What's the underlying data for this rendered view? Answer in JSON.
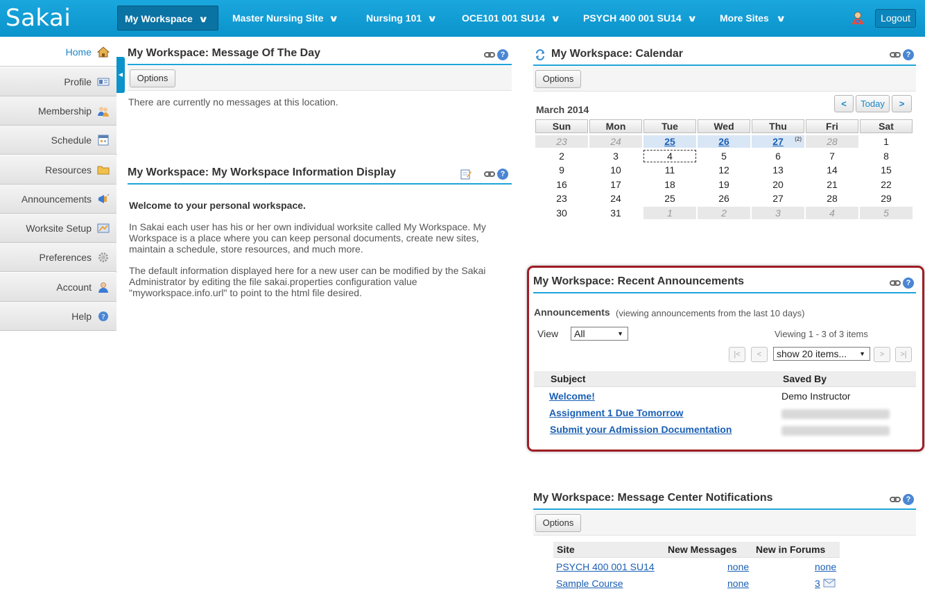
{
  "header": {
    "logo": "Sakai",
    "sites": [
      {
        "label": "My Workspace"
      },
      {
        "label": "Master Nursing Site"
      },
      {
        "label": "Nursing 101"
      },
      {
        "label": "OCE101 001 SU14"
      },
      {
        "label": "PSYCH 400 001 SU14"
      },
      {
        "label": "More Sites"
      }
    ],
    "logout": "Logout"
  },
  "sidebar": {
    "items": [
      {
        "label": "Home",
        "icon": "home-icon"
      },
      {
        "label": "Profile",
        "icon": "id-card-icon"
      },
      {
        "label": "Membership",
        "icon": "members-icon"
      },
      {
        "label": "Schedule",
        "icon": "calendar-icon"
      },
      {
        "label": "Resources",
        "icon": "folder-icon"
      },
      {
        "label": "Announcements",
        "icon": "megaphone-icon"
      },
      {
        "label": "Worksite Setup",
        "icon": "worksite-icon"
      },
      {
        "label": "Preferences",
        "icon": "gear-icon"
      },
      {
        "label": "Account",
        "icon": "user-icon"
      },
      {
        "label": "Help",
        "icon": "help-icon"
      }
    ]
  },
  "motd": {
    "title": "My Workspace: Message Of The Day",
    "options": "Options",
    "empty": "There are currently no messages at this location."
  },
  "info": {
    "title": "My Workspace: My Workspace Information Display",
    "welcome": "Welcome to your personal workspace.",
    "p1": "In Sakai each user has his or her own individual worksite called My Workspace. My Workspace is a place where you can keep personal documents, create new sites, maintain a schedule, store resources, and much more.",
    "p2": "The default information displayed here for a new user can be modified by the Sakai Administrator by editing the file sakai.properties configuration value \"myworkspace.info.url\" to point to the html file desired."
  },
  "calendar": {
    "title": "My Workspace: Calendar",
    "options": "Options",
    "month": "March 2014",
    "prev": "<",
    "today": "Today",
    "next": ">",
    "weekdays": [
      "Sun",
      "Mon",
      "Tue",
      "Wed",
      "Thu",
      "Fri",
      "Sat"
    ],
    "weeks": [
      [
        {
          "d": "23",
          "t": "other"
        },
        {
          "d": "24",
          "t": "other"
        },
        {
          "d": "25",
          "t": "event"
        },
        {
          "d": "26",
          "t": "event"
        },
        {
          "d": "27",
          "t": "event",
          "sup": "(2)"
        },
        {
          "d": "28",
          "t": "other"
        },
        {
          "d": "1",
          "t": ""
        }
      ],
      [
        {
          "d": "2",
          "t": ""
        },
        {
          "d": "3",
          "t": ""
        },
        {
          "d": "4",
          "t": "today"
        },
        {
          "d": "5",
          "t": ""
        },
        {
          "d": "6",
          "t": ""
        },
        {
          "d": "7",
          "t": ""
        },
        {
          "d": "8",
          "t": ""
        }
      ],
      [
        {
          "d": "9",
          "t": ""
        },
        {
          "d": "10",
          "t": ""
        },
        {
          "d": "11",
          "t": ""
        },
        {
          "d": "12",
          "t": ""
        },
        {
          "d": "13",
          "t": ""
        },
        {
          "d": "14",
          "t": ""
        },
        {
          "d": "15",
          "t": ""
        }
      ],
      [
        {
          "d": "16",
          "t": ""
        },
        {
          "d": "17",
          "t": ""
        },
        {
          "d": "18",
          "t": ""
        },
        {
          "d": "19",
          "t": ""
        },
        {
          "d": "20",
          "t": ""
        },
        {
          "d": "21",
          "t": ""
        },
        {
          "d": "22",
          "t": ""
        }
      ],
      [
        {
          "d": "23",
          "t": ""
        },
        {
          "d": "24",
          "t": ""
        },
        {
          "d": "25",
          "t": ""
        },
        {
          "d": "26",
          "t": ""
        },
        {
          "d": "27",
          "t": ""
        },
        {
          "d": "28",
          "t": ""
        },
        {
          "d": "29",
          "t": ""
        }
      ],
      [
        {
          "d": "30",
          "t": ""
        },
        {
          "d": "31",
          "t": ""
        },
        {
          "d": "1",
          "t": "other"
        },
        {
          "d": "2",
          "t": "other"
        },
        {
          "d": "3",
          "t": "other"
        },
        {
          "d": "4",
          "t": "other"
        },
        {
          "d": "5",
          "t": "other"
        }
      ]
    ]
  },
  "announcements": {
    "title": "My Workspace: Recent Announcements",
    "heading": "Announcements",
    "subheading": "(viewing announcements from the last 10 days)",
    "view_label": "View",
    "view_value": "All",
    "viewing": "Viewing 1 - 3 of 3 items",
    "page_size": "show 20 items...",
    "first": "|<",
    "prev": "<",
    "next": ">",
    "last": ">|",
    "col_subject": "Subject",
    "col_saved_by": "Saved By",
    "rows": [
      {
        "subject": "Welcome!",
        "saved_by": "Demo Instructor"
      },
      {
        "subject": "Assignment 1 Due Tomorrow",
        "saved_by": ""
      },
      {
        "subject": "Submit your Admission Documentation",
        "saved_by": ""
      }
    ]
  },
  "messages": {
    "title": "My Workspace: Message Center Notifications",
    "options": "Options",
    "col_site": "Site",
    "col_new_messages": "New Messages",
    "col_new_forums": "New in Forums",
    "rows": [
      {
        "site": "PSYCH 400 001 SU14",
        "messages": "none",
        "forums": "none"
      },
      {
        "site": "Sample Course",
        "messages": "none",
        "forums": "3"
      }
    ]
  }
}
